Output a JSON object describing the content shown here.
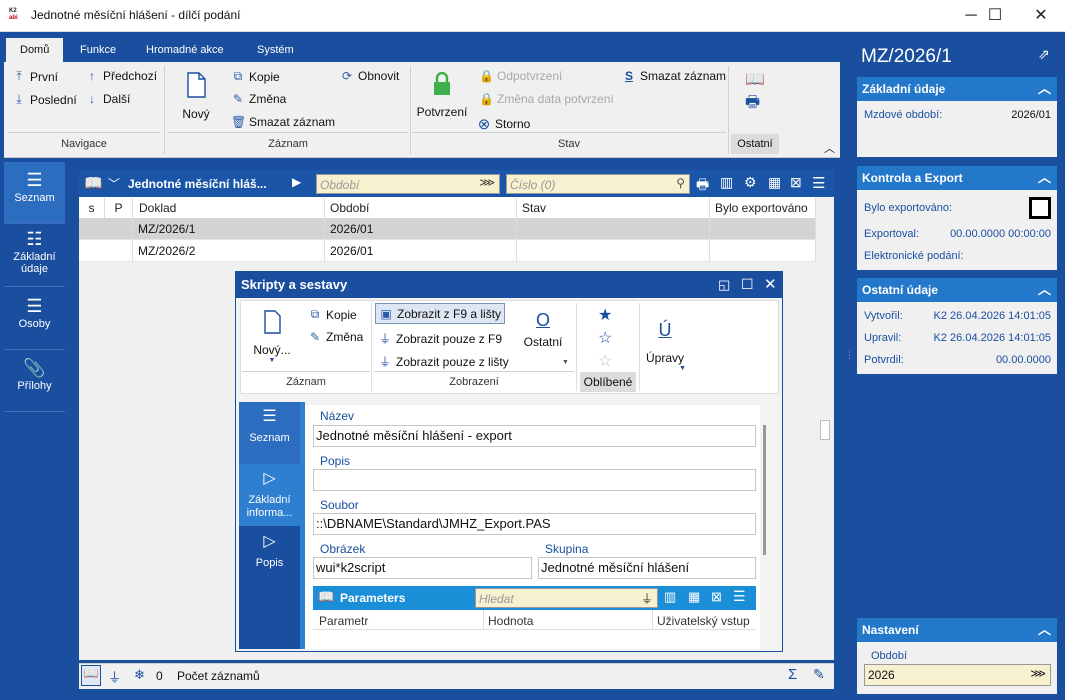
{
  "window": {
    "title": "Jednotné měsíční hlášení - dílčí podání",
    "logo_top": "K2",
    "logo_bottom": "abi",
    "minimize": "─",
    "maximize": "☐",
    "close": "✕"
  },
  "ribbon": {
    "tabs": [
      "Domů",
      "Funkce",
      "Hromadné akce",
      "Systém"
    ],
    "nav": {
      "first": "První",
      "last": "Poslední",
      "prev": "Předchozí",
      "next": "Další",
      "group": "Navigace"
    },
    "record": {
      "new": "Nový",
      "copy": "Kopie",
      "change": "Změna",
      "delete": "Smazat záznam",
      "refresh": "Obnovit",
      "group": "Záznam"
    },
    "state": {
      "confirm": "Potvrzení",
      "unconfirm": "Odpotvrzení",
      "change_date": "Změna data potvrzení",
      "cancel": "Storno",
      "delete": "Smazat záznam",
      "group": "Stav"
    },
    "other": {
      "group": "Ostatní"
    }
  },
  "left_tabs": [
    "Seznam",
    "Základní údaje",
    "Osoby",
    "Přílohy"
  ],
  "grid": {
    "title": "Jednotné měsíční hláš...",
    "filter_placeholder": "Období",
    "search_placeholder": "Číslo (0)",
    "columns": [
      "s",
      "P",
      "Doklad",
      "Období",
      "Stav",
      "Bylo exportováno"
    ],
    "rows": [
      {
        "doklad": "MZ/2026/1",
        "obdobi": "2026/01",
        "stav": "",
        "exported": ""
      },
      {
        "doklad": "MZ/2026/2",
        "obdobi": "2026/01",
        "stav": "",
        "exported": ""
      }
    ]
  },
  "status": {
    "count": "0",
    "label": "Počet záznamů"
  },
  "dialog": {
    "title": "Skripty a sestavy",
    "ribbon": {
      "new": "Nový...",
      "copy": "Kopie",
      "change": "Změna",
      "record_group": "Záznam",
      "show_f9_bar": "Zobrazit z F9 a lišty",
      "show_f9": "Zobrazit pouze z F9",
      "show_bar": "Zobrazit pouze z lišty",
      "view_group": "Zobrazení",
      "other": "Ostatní",
      "favorites": "Oblíbené",
      "edits": "Úpravy"
    },
    "tabs": [
      "Seznam",
      "Základní informa...",
      "Popis"
    ],
    "form": {
      "name_label": "Název",
      "name": "Jednotné měsíční hlášení - export",
      "desc_label": "Popis",
      "desc": "",
      "file_label": "Soubor",
      "file": "::\\DBNAME\\Standard\\JMHZ_Export.PAS",
      "image_label": "Obrázek",
      "image": "wui*k2script",
      "group_label": "Skupina",
      "group": "Jednotné měsíční hlášení"
    },
    "params": {
      "title": "Parameters",
      "search_placeholder": "Hledat",
      "columns": [
        "Parametr",
        "Hodnota",
        "Uživatelský vstup"
      ]
    }
  },
  "right": {
    "doc": "MZ/2026/1",
    "basic": {
      "title": "Základní údaje",
      "period_label": "Mzdové období:",
      "period": "2026/01"
    },
    "control": {
      "title": "Kontrola a Export",
      "exported_label": "Bylo exportováno:",
      "exported_at_label": "Exportoval:",
      "exported_at": "00.00.0000 00:00:00",
      "efile_label": "Elektronické podání:"
    },
    "other": {
      "title": "Ostatní údaje",
      "created_label": "Vytvořil:",
      "created": "K2 26.04.2026 14:01:05",
      "modified_label": "Upravil:",
      "modified": "K2 26.04.2026 14:01:05",
      "confirmed_label": "Potvrdil:",
      "confirmed": "00.00.0000"
    },
    "settings": {
      "title": "Nastavení",
      "period_label": "Období",
      "period": "2026"
    }
  }
}
